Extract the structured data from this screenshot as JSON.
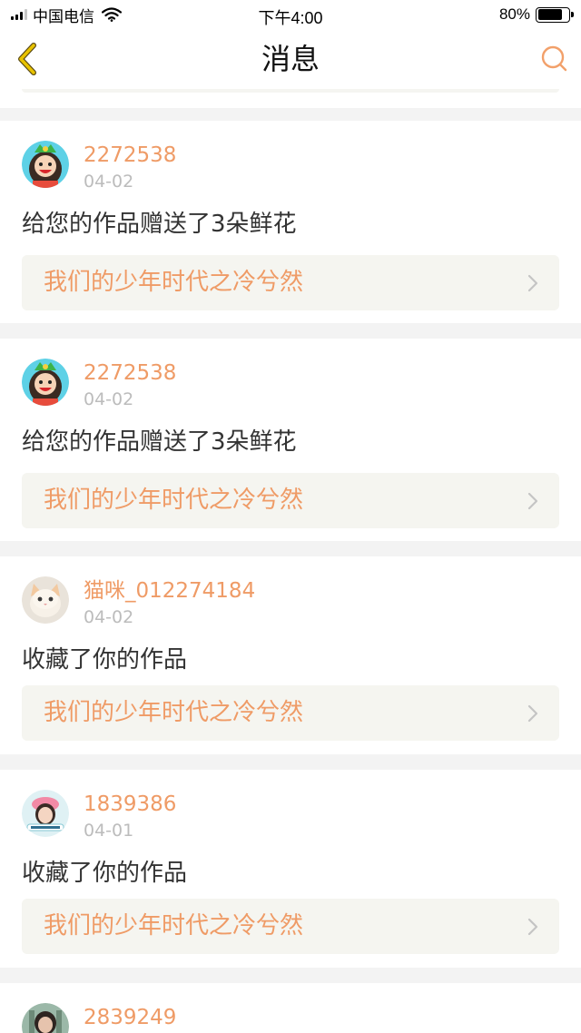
{
  "status_bar": {
    "carrier": "中国电信",
    "time": "下午4:00",
    "battery_percent": "80%",
    "battery_level": 0.8,
    "signal_bars_on": 3,
    "signal_bars_total": 4
  },
  "nav": {
    "title": "消息",
    "back_icon": "chevron-left-icon",
    "search_icon": "search-icon"
  },
  "colors": {
    "accent": "#ef9b66",
    "back_arrow": "#e8c200",
    "date_gray": "#bcbcbc",
    "card_box": "#f5f5f0",
    "page_bg": "#f3f3f3"
  },
  "messages": [
    {
      "username": "2272538",
      "date": "04-02",
      "action": "给您的作品赠送了3朵鲜花",
      "work_title": "我们的少年时代之冷兮然",
      "avatar": "cartoon-girl-avatar"
    },
    {
      "username": "2272538",
      "date": "04-02",
      "action": "给您的作品赠送了3朵鲜花",
      "work_title": "我们的少年时代之冷兮然",
      "avatar": "cartoon-girl-avatar"
    },
    {
      "username": "猫咪_012274184",
      "date": "04-02",
      "action": "收藏了你的作品",
      "work_title": "我们的少年时代之冷兮然",
      "avatar": "kitten-photo-avatar"
    },
    {
      "username": "1839386",
      "date": "04-01",
      "action": "收藏了你的作品",
      "work_title": "我们的少年时代之冷兮然",
      "avatar": "girl-photo-avatar"
    },
    {
      "username": "2839249",
      "date": "",
      "action": "",
      "work_title": "",
      "avatar": "photo-avatar"
    }
  ]
}
